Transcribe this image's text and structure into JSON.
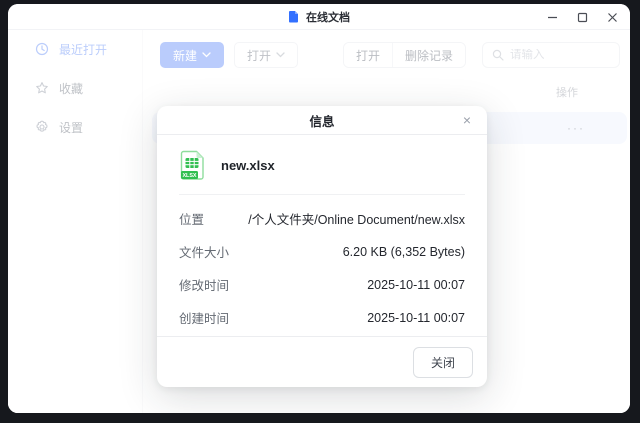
{
  "window": {
    "title": "在线文档"
  },
  "icons": {
    "app": "document-icon",
    "minimize": "–",
    "maximize": "□",
    "close": "×"
  },
  "sidebar": {
    "items": [
      {
        "label": "最近打开",
        "icon": "clock-icon",
        "active": true
      },
      {
        "label": "收藏",
        "icon": "star-icon",
        "active": false
      },
      {
        "label": "设置",
        "icon": "gear-icon",
        "active": false
      }
    ]
  },
  "toolbar": {
    "new_label": "新建",
    "open_dropdown_label": "打开",
    "open_label": "打开",
    "delete_label": "删除记录",
    "search_placeholder": "请输入"
  },
  "list": {
    "actions_header": "操作",
    "row_actions": "···"
  },
  "modal": {
    "title": "信息",
    "close_icon": "×",
    "file_name": "new.xlsx",
    "file_badge": "XLSX",
    "rows": [
      {
        "label": "位置",
        "value": "/个人文件夹/Online Document/new.xlsx"
      },
      {
        "label": "文件大小",
        "value": "6.20 KB (6,352 Bytes)"
      },
      {
        "label": "修改时间",
        "value": "2025-10-11 00:07"
      },
      {
        "label": "创建时间",
        "value": "2025-10-11 00:07"
      }
    ],
    "close_button": "关闭"
  },
  "colors": {
    "accent": "#4a79f6",
    "file_green": "#31bf50",
    "selected_row": "#e9effc"
  }
}
